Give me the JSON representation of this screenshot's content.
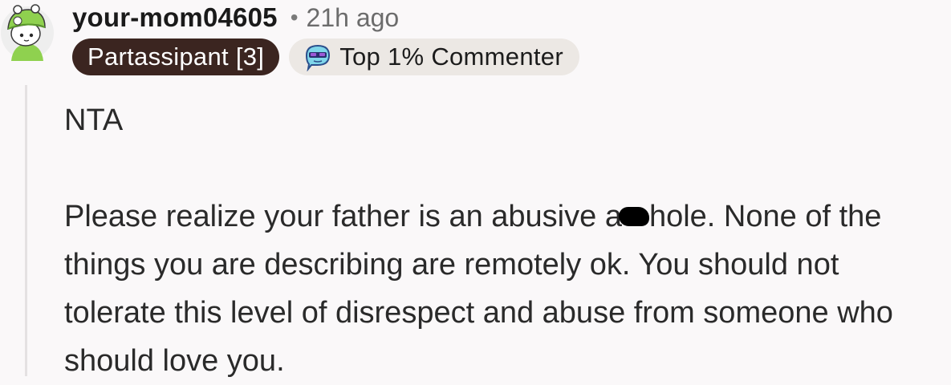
{
  "comment": {
    "author": "your-mom04605",
    "separator": "•",
    "time_ago": "21h ago",
    "user_flair": "Partassipant [3]",
    "achievement_flair": "Top 1% Commenter",
    "avatar_icon": "snoo-avatar-icon",
    "badge_icon": "top-commenter-badge-icon",
    "body": {
      "verdict": "NTA",
      "text_before_censor": "Please realize your father is an abusive a",
      "text_after_censor": "hole. None of the things you are describing are remotely ok. You should not tolerate this level of disrespect and abuse from someone who should love you."
    }
  },
  "colors": {
    "background": "#faf8f9",
    "user_flair_bg": "#3b2520",
    "achievement_flair_bg": "#ece8e4",
    "avatar_green": "#8fd14f",
    "thread_line": "#e4e1e2"
  }
}
